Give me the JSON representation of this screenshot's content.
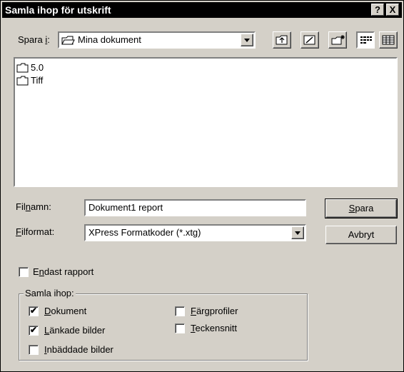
{
  "window": {
    "title": "Samla ihop för utskrift",
    "help_label": "?",
    "close_label": "X"
  },
  "save_in": {
    "label_pre": "Spara ",
    "label_u": "i",
    "label_post": ":",
    "value": "Mina dokument",
    "icon": "mydocs-folder-icon"
  },
  "toolbar": {
    "icons": [
      "up-folder-icon",
      "desktop-icon",
      "new-folder-icon",
      "list-view-icon",
      "details-view-icon"
    ]
  },
  "files": [
    {
      "name": "5.0",
      "icon": "folder-icon"
    },
    {
      "name": "Tiff",
      "icon": "folder-icon"
    }
  ],
  "filename": {
    "label_pre": "Fil",
    "label_u": "n",
    "label_post": "amn:",
    "value": "Dokument1 report"
  },
  "fileformat": {
    "label_u": "F",
    "label_post": "ilformat:",
    "value": "XPress Formatkoder (*.xtg)"
  },
  "buttons": {
    "save_u": "S",
    "save_rest": "para",
    "cancel": "Avbryt"
  },
  "report_only": {
    "label_pre": "E",
    "label_u": "n",
    "label_post": "dast rapport",
    "checked": false
  },
  "collect": {
    "legend": "Samla ihop:",
    "items": [
      {
        "u": "D",
        "rest": "okument",
        "checked": true
      },
      {
        "u": "L",
        "rest": "änkade bilder",
        "checked": true
      },
      {
        "u": "I",
        "rest": "nbäddade bilder",
        "checked": false
      },
      {
        "u": "F",
        "rest": "ärgprofiler",
        "checked": false
      },
      {
        "u": "T",
        "rest": "eckensnitt",
        "checked": false
      }
    ],
    "check_mark": "✔"
  }
}
